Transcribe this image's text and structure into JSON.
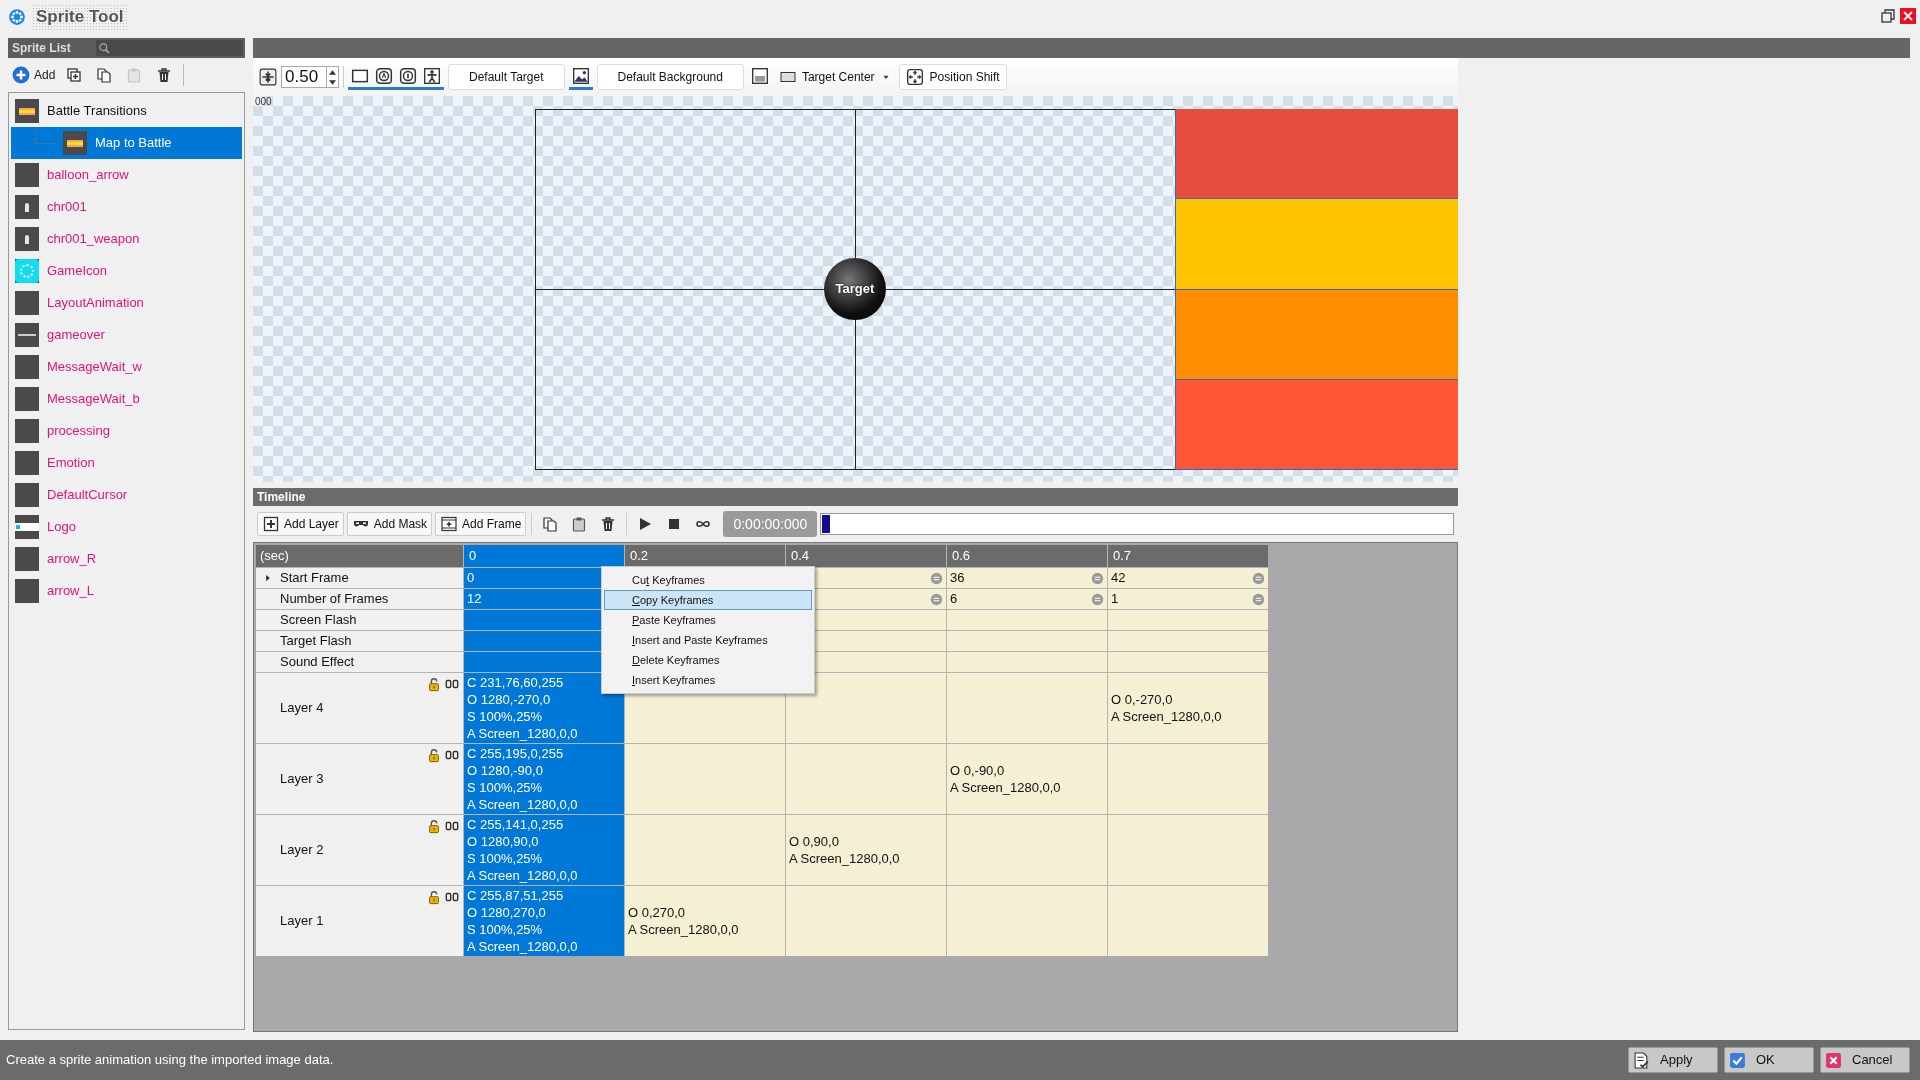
{
  "window": {
    "title": "Sprite Tool"
  },
  "sprite_list": {
    "title": "Sprite List",
    "toolbar": [
      {
        "label": "Add",
        "disabled": false
      },
      {
        "disabled": false
      },
      {
        "disabled": false
      },
      {
        "disabled": true
      },
      {
        "disabled": false
      }
    ],
    "items": [
      {
        "label": "Battle Transitions",
        "kind": "group",
        "thumbnail": {
          "kind": "stripe"
        },
        "selected": false,
        "children": [
          {
            "label": "Map to Battle",
            "kind": "animation",
            "thumbnail": {
              "kind": "stripe"
            },
            "selected": true
          }
        ]
      },
      {
        "label": "balloon_arrow",
        "kind": "sprite",
        "thumbnail": {
          "kind": "blank"
        },
        "selected": false
      },
      {
        "label": "chr001",
        "kind": "sprite",
        "thumbnail": {
          "kind": "figure"
        },
        "selected": false
      },
      {
        "label": "chr001_weapon",
        "kind": "sprite",
        "thumbnail": {
          "kind": "figure"
        },
        "selected": false
      },
      {
        "label": "GameIcon",
        "kind": "sprite",
        "thumbnail": {
          "kind": "dots"
        },
        "selected": false
      },
      {
        "label": "LayoutAnimation",
        "kind": "sprite",
        "thumbnail": {
          "kind": "blank"
        },
        "selected": false
      },
      {
        "label": "gameover",
        "kind": "sprite",
        "thumbnail": {
          "kind": "banner"
        },
        "selected": false
      },
      {
        "label": "MessageWait_w",
        "kind": "sprite",
        "thumbnail": {
          "kind": "blank"
        },
        "selected": false
      },
      {
        "label": "MessageWait_b",
        "kind": "sprite",
        "thumbnail": {
          "kind": "blank"
        },
        "selected": false
      },
      {
        "label": "processing",
        "kind": "sprite",
        "thumbnail": {
          "kind": "blank"
        },
        "selected": false
      },
      {
        "label": "Emotion",
        "kind": "sprite",
        "thumbnail": {
          "kind": "blank"
        },
        "selected": false
      },
      {
        "label": "DefaultCursor",
        "kind": "sprite",
        "thumbnail": {
          "kind": "blank"
        },
        "selected": false
      },
      {
        "label": "Logo",
        "kind": "sprite",
        "thumbnail": {
          "kind": "logo"
        },
        "selected": false
      },
      {
        "label": "arrow_R",
        "kind": "sprite",
        "thumbnail": {
          "kind": "blank"
        },
        "selected": false
      },
      {
        "label": "arrow_L",
        "kind": "sprite",
        "thumbnail": {
          "kind": "blank"
        },
        "selected": false
      }
    ]
  },
  "editor_toolbar": [
    {
      "kind": "zoom_field",
      "value": "0.50"
    },
    {
      "kind": "toggle",
      "on": true
    },
    {
      "kind": "toggle",
      "on": true
    },
    {
      "kind": "toggle",
      "on": true
    },
    {
      "kind": "toggle",
      "on": true
    },
    {
      "kind": "button",
      "label": "Default Target"
    },
    {
      "kind": "toggle",
      "on": true
    },
    {
      "kind": "button",
      "label": "Default Background"
    },
    {
      "kind": "toggle",
      "on": false
    },
    {
      "kind": "dropdown",
      "label": "Target Center"
    },
    {
      "kind": "button",
      "label": "Position Shift"
    }
  ],
  "canvas": {
    "corner_label": "000",
    "target_label": "Target",
    "bars": [
      {
        "color": "#e74c3c"
      },
      {
        "color": "#ffc300"
      },
      {
        "color": "#ff8d00"
      },
      {
        "color": "#ff5733"
      }
    ]
  },
  "timeline": {
    "title": "Timeline",
    "toolbar": [
      {
        "kind": "button",
        "label": "Add Layer"
      },
      {
        "kind": "button",
        "label": "Add Mask"
      },
      {
        "kind": "button",
        "label": "Add Frame"
      },
      {
        "kind": "icon"
      },
      {
        "kind": "icon"
      },
      {
        "kind": "icon"
      },
      {
        "kind": "icon"
      },
      {
        "kind": "icon"
      },
      {
        "kind": "icon"
      }
    ],
    "time": "0:00:00:000",
    "scrubber": {
      "level": 0
    },
    "unit_label": "(sec)",
    "columns": [
      {
        "label": "0",
        "selected": true
      },
      {
        "label": "0.2",
        "selected": false
      },
      {
        "label": "0.4",
        "selected": false
      },
      {
        "label": "0.6",
        "selected": false
      },
      {
        "label": "0.7",
        "selected": false
      }
    ],
    "properties": [
      {
        "label": "Start Frame",
        "kind": "number_group",
        "cells": [
          "0",
          null,
          null,
          "36",
          "42"
        ]
      },
      {
        "label": "Number of Frames",
        "kind": "number",
        "cells": [
          "12",
          null,
          null,
          "6",
          "1"
        ]
      },
      {
        "label": "Screen Flash",
        "kind": "event"
      },
      {
        "label": "Target Flash",
        "kind": "event"
      },
      {
        "label": "Sound Effect",
        "kind": "event"
      }
    ],
    "layers": [
      {
        "name": "Layer 4",
        "locked": false,
        "cells": [
          [
            "C 231,76,60,255",
            "O 1280,-270,0",
            "S 100%,25%",
            "A Screen_1280,0,0"
          ],
          null,
          null,
          null,
          [
            "O 0,-270,0",
            "A Screen_1280,0,0"
          ]
        ]
      },
      {
        "name": "Layer 3",
        "locked": false,
        "cells": [
          [
            "C 255,195,0,255",
            "O 1280,-90,0",
            "S 100%,25%",
            "A Screen_1280,0,0"
          ],
          null,
          null,
          [
            "O 0,-90,0",
            "A Screen_1280,0,0"
          ],
          null
        ]
      },
      {
        "name": "Layer 2",
        "locked": false,
        "cells": [
          [
            "C 255,141,0,255",
            "O 1280,90,0",
            "S 100%,25%",
            "A Screen_1280,0,0"
          ],
          null,
          [
            "O 0,90,0",
            "A Screen_1280,0,0"
          ],
          null,
          null
        ]
      },
      {
        "name": "Layer 1",
        "locked": false,
        "cells": [
          [
            "C 255,87,51,255",
            "O 1280,270,0",
            "S 100%,25%",
            "A Screen_1280,0,0"
          ],
          [
            "O 0,270,0",
            "A Screen_1280,0,0"
          ],
          null,
          null,
          null
        ]
      }
    ]
  },
  "context_menu": {
    "items": [
      {
        "before": "Cu",
        "key": "t",
        "after": " Keyframes",
        "selected": false
      },
      {
        "key": "C",
        "after": "opy Keyframes",
        "selected": true
      },
      {
        "key": "P",
        "after": "aste Keyframes",
        "selected": false
      },
      {
        "key": "I",
        "after": "nsert and Paste Keyframes",
        "selected": false
      },
      {
        "key": "D",
        "after": "elete Keyframes",
        "selected": false
      },
      {
        "key": "I",
        "after": "nsert Keyframes",
        "selected": false
      }
    ]
  },
  "status_bar": {
    "message": "Create a sprite animation using the imported image data.",
    "buttons": [
      {
        "label": "Apply",
        "kind": "apply"
      },
      {
        "label": "OK",
        "kind": "ok"
      },
      {
        "label": "Cancel",
        "kind": "cancel"
      }
    ]
  }
}
